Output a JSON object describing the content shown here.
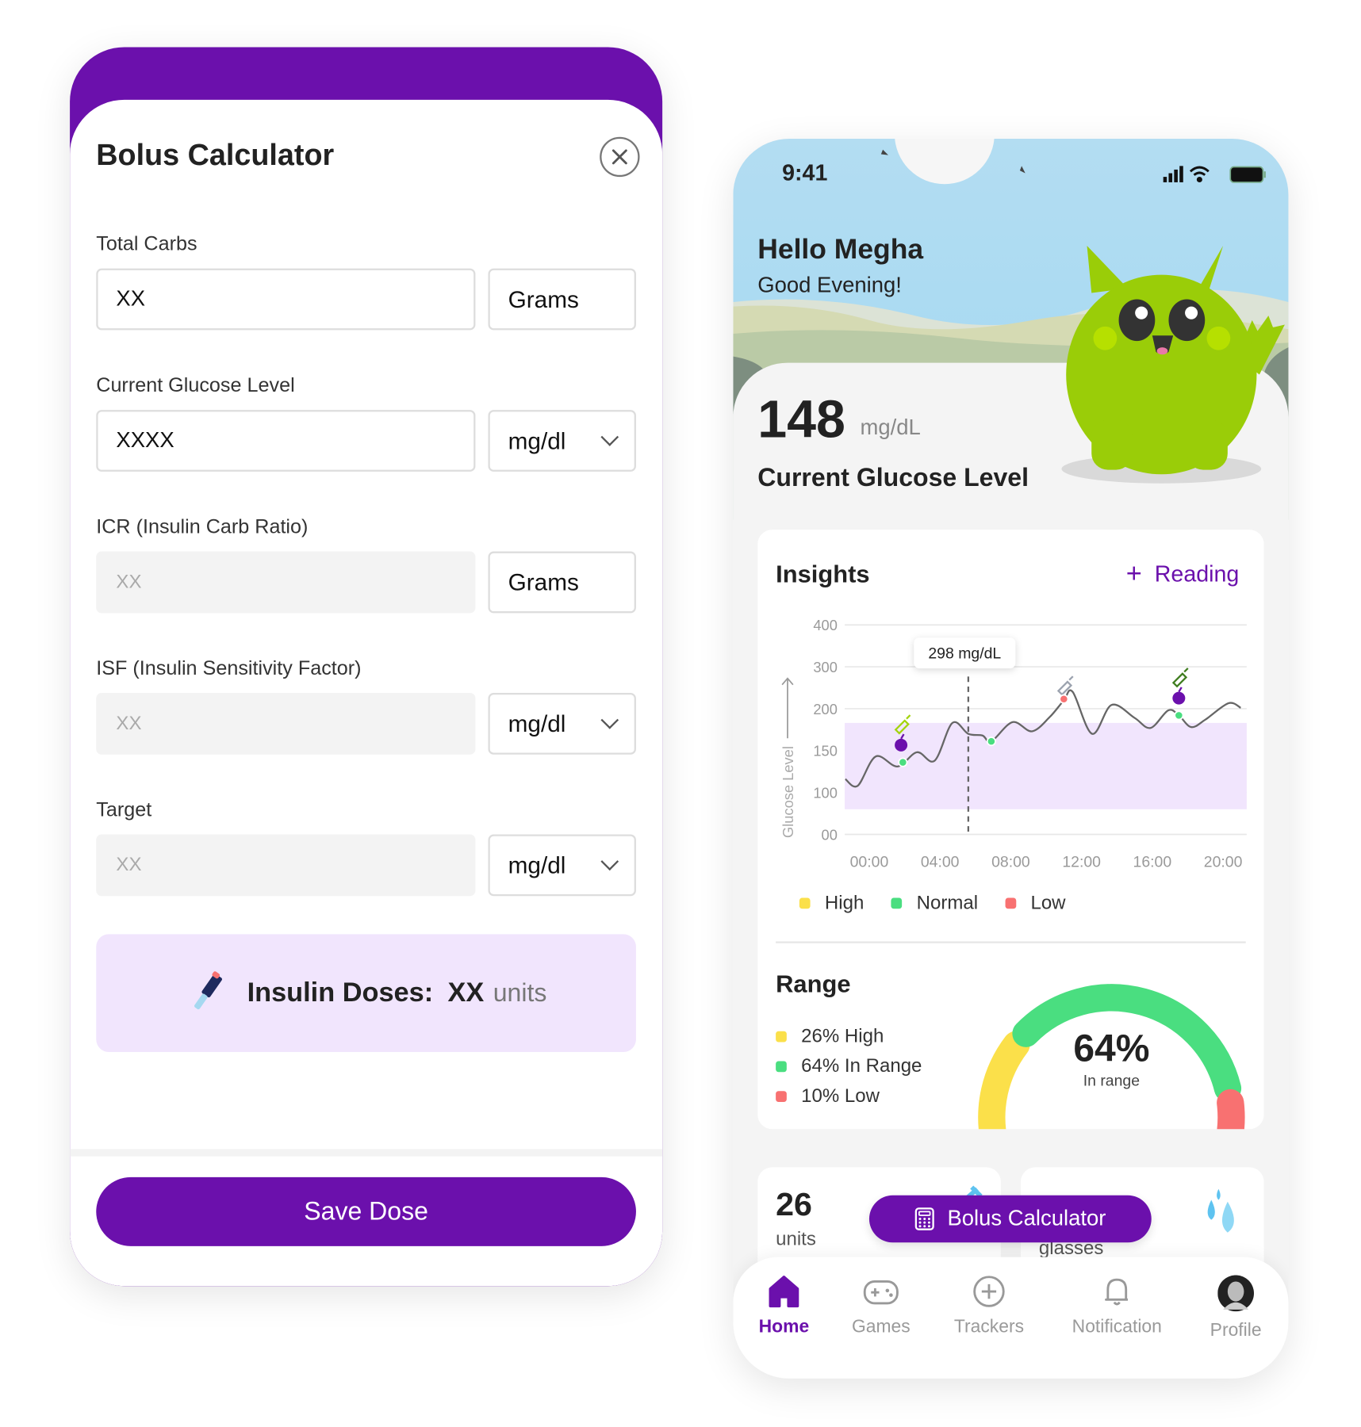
{
  "bolus_calculator": {
    "title": "Bolus Calculator",
    "fields": [
      {
        "label": "Total Carbs",
        "value": "XX",
        "unit": "Grams",
        "unit_dropdown": false,
        "disabled": false
      },
      {
        "label": "Current Glucose Level",
        "value": "XXXX",
        "unit": "mg/dl",
        "unit_dropdown": true,
        "disabled": false
      },
      {
        "label": "ICR (Insulin Carb Ratio)",
        "value": "XX",
        "unit": "Grams",
        "unit_dropdown": false,
        "disabled": true
      },
      {
        "label": "ISF (Insulin Sensitivity Factor)",
        "value": "XX",
        "unit": "mg/dl",
        "unit_dropdown": true,
        "disabled": true
      },
      {
        "label": "Target",
        "value": "XX",
        "unit": "mg/dl",
        "unit_dropdown": true,
        "disabled": true
      }
    ],
    "result": {
      "label": "Insulin Doses:",
      "value": "XX",
      "unit": "units"
    },
    "save_label": "Save Dose",
    "colors": {
      "brand": "#6B10AC",
      "result_bg": "#F1E5FD"
    }
  },
  "phone": {
    "status": {
      "time": "9:41"
    },
    "greeting": {
      "title": "Hello Megha",
      "subtitle": "Good Evening!"
    },
    "glucose": {
      "value": "148",
      "unit": "mg/dL",
      "label": "Current Glucose Level"
    },
    "insights": {
      "title": "Insights",
      "add_reading_label": "Reading",
      "legend": [
        {
          "label": "High",
          "color": "#FBE04A"
        },
        {
          "label": "Normal",
          "color": "#4ADE80"
        },
        {
          "label": "Low",
          "color": "#F87171"
        }
      ]
    },
    "range": {
      "title": "Range",
      "items": [
        {
          "label": "26% High",
          "percent": 26,
          "color": "#FBE04A"
        },
        {
          "label": "64% In Range",
          "percent": 64,
          "color": "#4ADE80"
        },
        {
          "label": "10% Low",
          "percent": 10,
          "color": "#F87171"
        }
      ],
      "center_value": "64%",
      "center_label": "In range"
    },
    "stat_cards": [
      {
        "value": "26",
        "unit": "units",
        "icon": "syringe-icon"
      },
      {
        "unit": "glasses",
        "icon": "water-drops-icon"
      }
    ],
    "floating_button": "Bolus Calculator",
    "nav": [
      {
        "label": "Home",
        "icon": "home-icon",
        "active": true
      },
      {
        "label": "Games",
        "icon": "gamepad-icon",
        "active": false
      },
      {
        "label": "Trackers",
        "icon": "plus-circle-icon",
        "active": false
      },
      {
        "label": "Notification",
        "icon": "bell-icon",
        "active": false
      },
      {
        "label": "Profile",
        "icon": "avatar",
        "active": false
      }
    ]
  },
  "chart_data": {
    "type": "line",
    "ylabel": "Glucose Level",
    "yticks": [
      0,
      100,
      150,
      200,
      300,
      400
    ],
    "ytick_labels": [
      "00",
      "100",
      "150",
      "200",
      "300",
      "400"
    ],
    "xtick_labels": [
      "00:00",
      "04:00",
      "08:00",
      "12:00",
      "16:00",
      "20:00"
    ],
    "xticks_hours": [
      0,
      4,
      8,
      12,
      16,
      20
    ],
    "x_range_hours": [
      -1.4,
      21.2
    ],
    "grid": true,
    "target_band": [
      60,
      183
    ],
    "series": [
      {
        "x": [
          -1.35,
          -0.65,
          0.37,
          1.6,
          2.7,
          3.7,
          4.7,
          5.6,
          6.4,
          6.9,
          8.1,
          9.2,
          10.2,
          11.0,
          11.5,
          12.6,
          13.7,
          15.0,
          15.9,
          16.9,
          17.5,
          18.2,
          19.0,
          20.3,
          21.0
        ],
        "y": [
          116,
          108,
          143,
          131,
          148,
          138,
          183,
          170,
          168,
          161,
          184,
          173,
          190,
          220,
          240,
          170,
          209,
          189,
          177,
          198,
          192,
          178,
          187,
          213,
          202
        ]
      }
    ],
    "points": [
      {
        "x": 1.9,
        "y": 136,
        "status": "Normal"
      },
      {
        "x": 6.9,
        "y": 161,
        "status": "Normal"
      },
      {
        "x": 11.0,
        "y": 223,
        "status": "Low"
      },
      {
        "x": 17.5,
        "y": 192,
        "status": "Normal"
      }
    ],
    "events": [
      {
        "x": 1.8,
        "type": "meal"
      },
      {
        "x": 1.8,
        "type": "insulin",
        "color": "#A3D40E"
      },
      {
        "x": 11.0,
        "type": "insulin",
        "color": "#9CA3AF"
      },
      {
        "x": 17.5,
        "type": "meal"
      },
      {
        "x": 17.5,
        "type": "insulin",
        "color": "#3F7D1F"
      }
    ],
    "tooltip": {
      "x": 5.6,
      "label": "298 mg/dL"
    },
    "legend": "bottom-left"
  }
}
